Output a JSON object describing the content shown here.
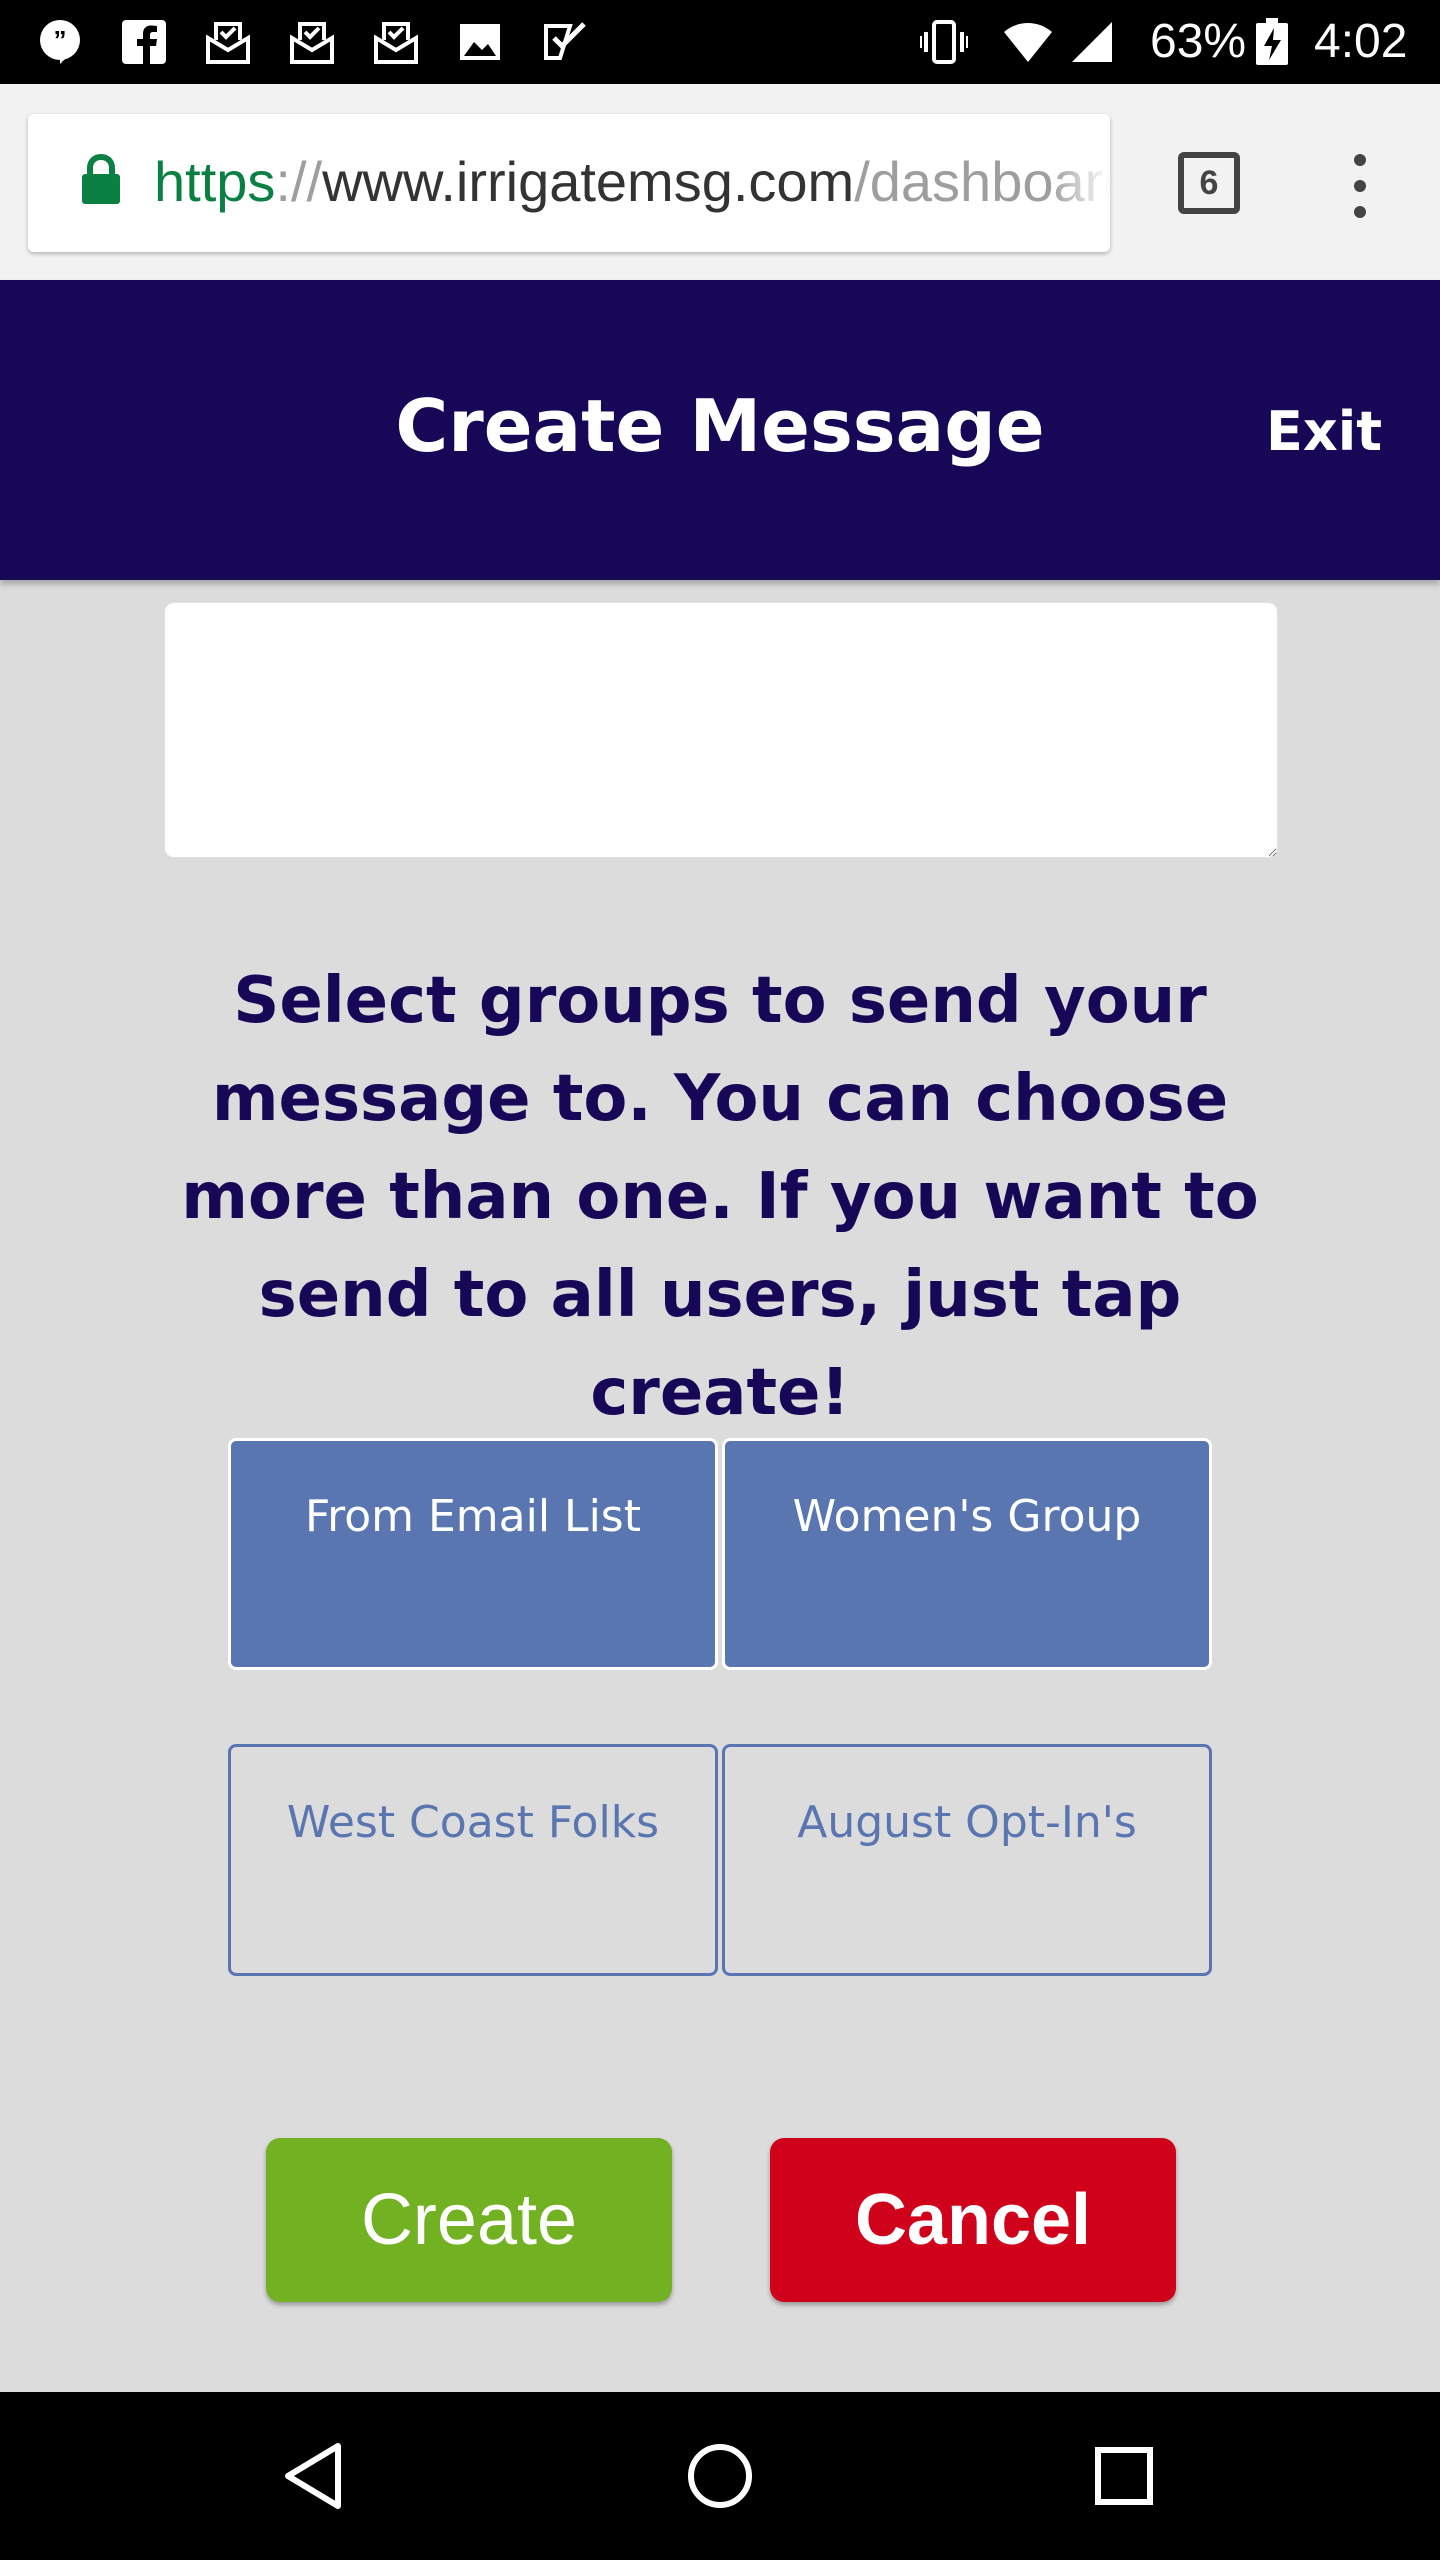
{
  "status_bar": {
    "battery": "63%",
    "time": "4:02",
    "icons": [
      "hangouts-icon",
      "facebook-icon",
      "mail-icon",
      "mail-icon",
      "mail-icon",
      "photo-icon",
      "task-icon",
      "vibrate-icon",
      "wifi-icon",
      "signal-icon",
      "battery-charging-icon"
    ]
  },
  "browser": {
    "url_scheme": "https",
    "url_sep": "://",
    "url_host": "www.irrigatemsg.com",
    "url_path": "/dashboard",
    "tab_count": "6"
  },
  "header": {
    "title": "Create Message",
    "exit_label": "Exit",
    "background": "#170757"
  },
  "message": {
    "value": ""
  },
  "instructions": "Select groups to send your message to. You can choose more than one. If you want to send to all users, just tap create!",
  "groups": [
    {
      "label": "From Email List",
      "selected": true
    },
    {
      "label": "Women's Group",
      "selected": true
    },
    {
      "label": "West Coast Folks",
      "selected": false
    },
    {
      "label": "August Opt-In's",
      "selected": false
    }
  ],
  "actions": {
    "create_label": "Create",
    "cancel_label": "Cancel",
    "create_color": "#72b122",
    "cancel_color": "#d0021b"
  },
  "group_colors": {
    "accent": "#5a76b0"
  }
}
